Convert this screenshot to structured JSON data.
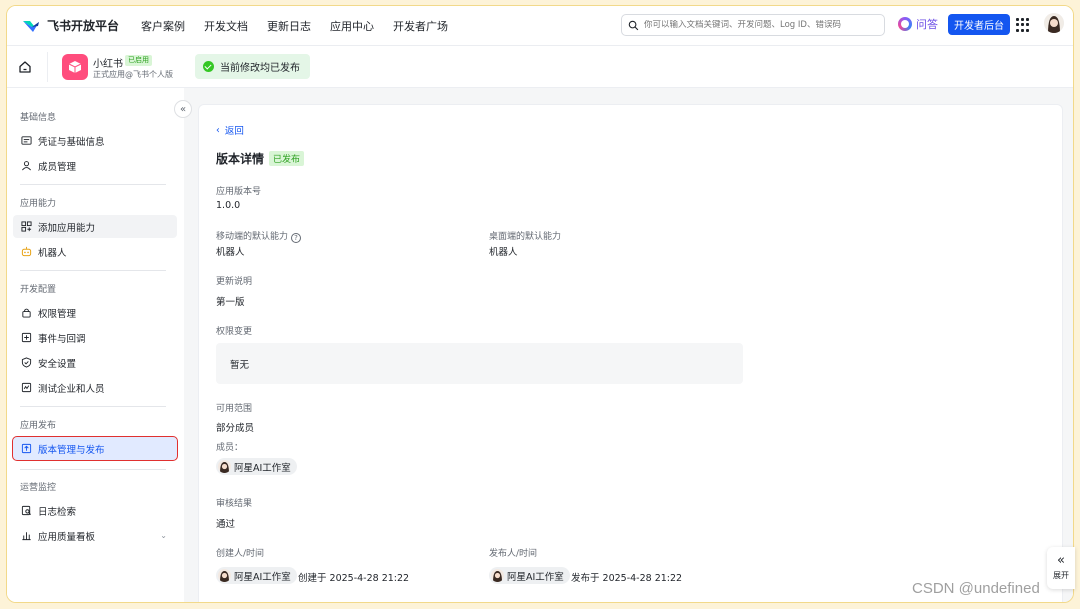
{
  "topnav": {
    "brand": "飞书开放平台",
    "links": [
      "客户案例",
      "开发文档",
      "更新日志",
      "应用中心",
      "开发者广场"
    ],
    "search_placeholder": "你可以输入文档关键词、开发问题、Log ID、错误码",
    "ask_label": "问答",
    "console_button": "开发者后台"
  },
  "appbar": {
    "app_name": "小红书",
    "app_badge": "已启用",
    "app_sub": "正式应用@飞书个人版",
    "status_text": "当前修改均已发布"
  },
  "sidebar": {
    "sections": [
      {
        "title": "基础信息",
        "items": [
          "凭证与基础信息",
          "成员管理"
        ]
      },
      {
        "title": "应用能力",
        "items": [
          "添加应用能力",
          "机器人"
        ]
      },
      {
        "title": "开发配置",
        "items": [
          "权限管理",
          "事件与回调",
          "安全设置",
          "测试企业和人员"
        ]
      },
      {
        "title": "应用发布",
        "items": [
          "版本管理与发布"
        ]
      },
      {
        "title": "运营监控",
        "items": [
          "日志检索",
          "应用质量看板"
        ]
      }
    ],
    "active_item": "版本管理与发布"
  },
  "detail": {
    "back_label": "返回",
    "title": "版本详情",
    "status_badge": "已发布",
    "version_label": "应用版本号",
    "version_value": "1.0.0",
    "mobile_label": "移动端的默认能力",
    "mobile_value": "机器人",
    "desktop_label": "桌面端的默认能力",
    "desktop_value": "机器人",
    "notes_label": "更新说明",
    "notes_value": "第一版",
    "perm_label": "权限变更",
    "perm_value": "暂无",
    "scope_label": "可用范围",
    "scope_value": "部分成员",
    "members_label": "成员：",
    "member_name": "阿星AI工作室",
    "review_label": "审核结果",
    "review_value": "通过",
    "creator_label": "创建人/时间",
    "creator_name": "阿星AI工作室",
    "creator_time": "创建于 2025-4-28 21:22",
    "publisher_label": "发布人/时间",
    "publisher_name": "阿星AI工作室",
    "publisher_time": "发布于 2025-4-28 21:22"
  },
  "expand_label": "展开",
  "watermark": "CSDN @undefined",
  "colors": {
    "primary": "#1456f0",
    "success": "#34c724",
    "highlight_border": "#e0302f",
    "app_icon": "#ff4d7d"
  }
}
